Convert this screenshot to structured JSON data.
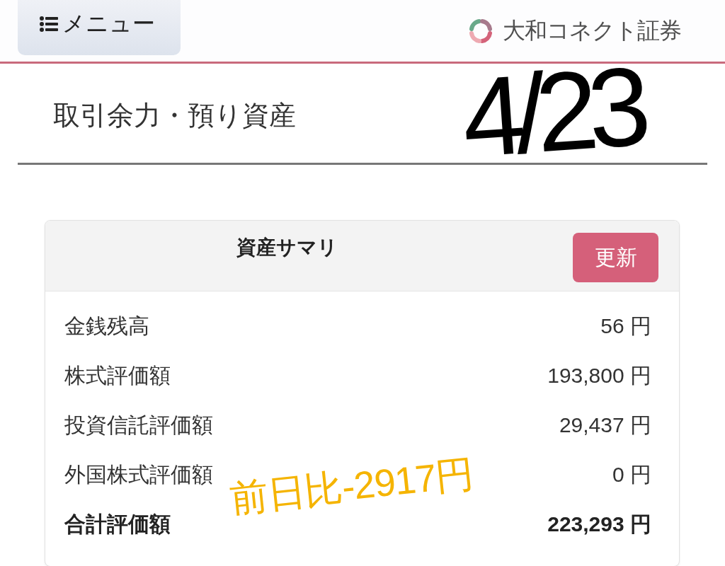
{
  "header": {
    "menu_button": {
      "label": "メニュー"
    },
    "logo": {
      "text": "大和コネクト証券"
    }
  },
  "page_title": "取引余力・預り資産",
  "summary": {
    "title": "資産サマリ",
    "refresh_button": "更新",
    "rows": [
      {
        "label": "金銭残高",
        "value": "56 円",
        "kind": "normal"
      },
      {
        "label": "株式評価額",
        "value": "193,800 円",
        "kind": "normal"
      },
      {
        "label": "投資信託評価額",
        "value": "29,437 円",
        "kind": "normal"
      },
      {
        "label": "外国株式評価額",
        "value": "0 円",
        "kind": "normal"
      },
      {
        "label": "合計評価額",
        "value": "223,293 円",
        "kind": "total"
      }
    ]
  },
  "annotations": [
    {
      "kind": "date",
      "text": "4/23",
      "color": "#000000"
    },
    {
      "kind": "note",
      "text": "前日比-2917円",
      "color": "#f5b400"
    }
  ]
}
